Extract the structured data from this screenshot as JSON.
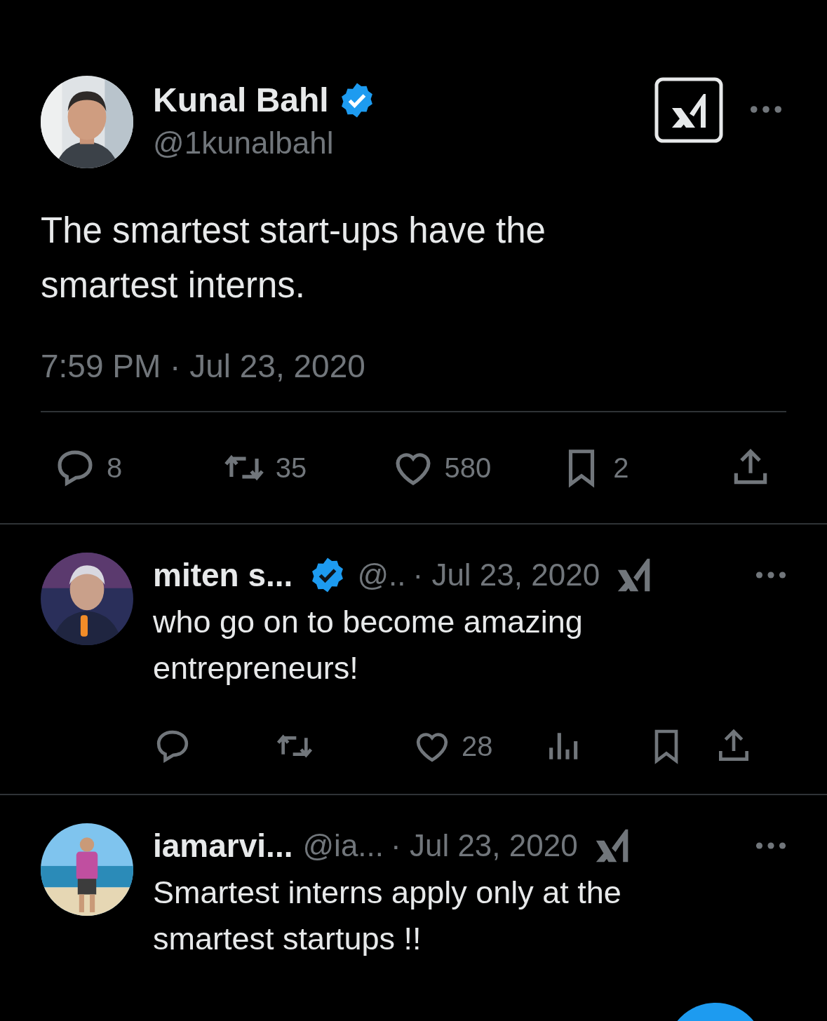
{
  "post": {
    "author": {
      "name": "Kunal Bahl",
      "verified": true,
      "handle": "@1kunalbahl"
    },
    "text": "The smartest start-ups have the smartest interns.",
    "timestamp": "7:59 PM · Jul 23, 2020",
    "actions": [
      {
        "kind": "reply",
        "count": "8"
      },
      {
        "kind": "repost",
        "count": "35"
      },
      {
        "kind": "like",
        "count": "580"
      },
      {
        "kind": "bookmark",
        "count": "2"
      },
      {
        "kind": "share"
      }
    ]
  },
  "replies": [
    {
      "name": "miten s...",
      "verified": true,
      "handle": "@..",
      "date": "· Jul 23, 2020",
      "text": "who go on to become amazing entrepreneurs!",
      "actions": [
        {
          "kind": "reply"
        },
        {
          "kind": "repost"
        },
        {
          "kind": "like",
          "count": "28"
        },
        {
          "kind": "views"
        },
        {
          "kind": "bookmark"
        },
        {
          "kind": "share"
        }
      ]
    },
    {
      "name": "iamarvi...",
      "verified": false,
      "handle": "@ia...",
      "date": "· Jul 23, 2020",
      "text": "Smartest interns apply only at the smartest startups !!"
    }
  ]
}
